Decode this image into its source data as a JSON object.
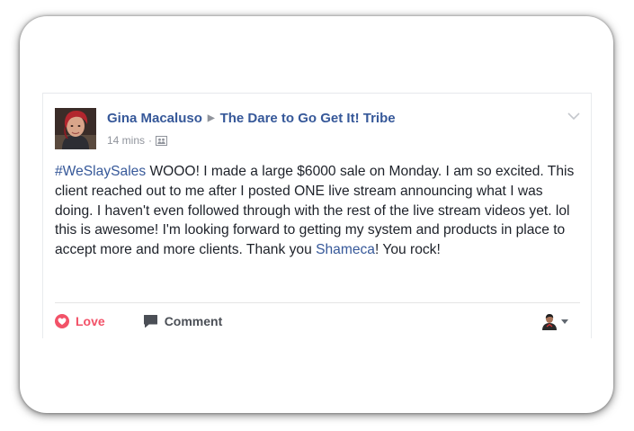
{
  "post": {
    "author": "Gina Macaluso",
    "group": "The Dare to Go Get It! Tribe",
    "time": "14 mins",
    "text": {
      "hashtag": "#WeSlaySales",
      "part1": " WOOO! I made a large $6000 sale on Monday. I am so excited. This client reached out to me after I posted ONE live stream announcing what I was doing. I haven't even followed through with the rest of the live stream videos yet. lol this is awesome! I'm looking forward to getting my system and products in place to accept more and more clients. Thank you ",
      "mention": "Shameca",
      "part2": "! You rock!"
    }
  },
  "actions": {
    "love_label": "Love",
    "comment_label": "Comment"
  },
  "colors": {
    "link": "#365899",
    "love": "#f25268",
    "text": "#1d2129",
    "muted": "#90949c"
  },
  "icons": {
    "author_arrow": "triangle-right-icon",
    "audience": "group-icon",
    "options": "chevron-down-icon",
    "love": "heart-icon",
    "comment": "comment-bubble-icon",
    "viewer": "user-avatar-icon"
  }
}
